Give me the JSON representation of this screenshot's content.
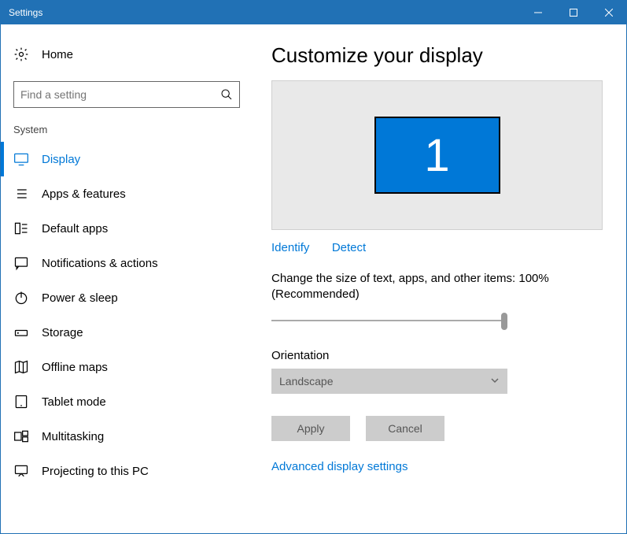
{
  "window": {
    "title": "Settings"
  },
  "sidebar": {
    "home": "Home",
    "search_placeholder": "Find a setting",
    "category": "System",
    "items": [
      {
        "label": "Display",
        "selected": true
      },
      {
        "label": "Apps & features"
      },
      {
        "label": "Default apps"
      },
      {
        "label": "Notifications & actions"
      },
      {
        "label": "Power & sleep"
      },
      {
        "label": "Storage"
      },
      {
        "label": "Offline maps"
      },
      {
        "label": "Tablet mode"
      },
      {
        "label": "Multitasking"
      },
      {
        "label": "Projecting to this PC"
      }
    ]
  },
  "main": {
    "title": "Customize your display",
    "monitor_number": "1",
    "identify": "Identify",
    "detect": "Detect",
    "scale_text": "Change the size of text, apps, and other items: 100% (Recommended)",
    "orientation_label": "Orientation",
    "orientation_value": "Landscape",
    "apply": "Apply",
    "cancel": "Cancel",
    "advanced": "Advanced display settings"
  }
}
